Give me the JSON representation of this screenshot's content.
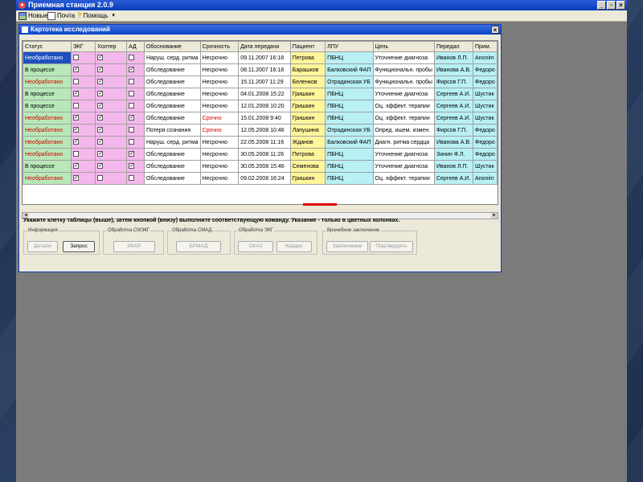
{
  "app": {
    "title": "Приемная станция 2.0.9",
    "window_buttons": [
      "_",
      "▫",
      "×"
    ]
  },
  "menu": {
    "new_label": "Новые",
    "mail_label": "Почта",
    "help_label": "Помощь",
    "help_arrow": "▾"
  },
  "dialog": {
    "title": "Картотека исследований",
    "close": "×"
  },
  "table": {
    "headers": [
      "Статус",
      "ЭКГ",
      "Холтер",
      "АД",
      "Обоснование",
      "Срочность",
      "Дата передачи",
      "Пациент",
      "ЛПУ",
      "Цель",
      "Передал",
      "Прим."
    ],
    "rows": [
      {
        "status": "Необработано",
        "ekg": false,
        "holter": true,
        "ad": false,
        "reason": "Наруш. серд. ритма",
        "urgency": "Несрочно",
        "date": "09.11.2007 16:18",
        "patient": "Петрова",
        "lpu": "ПБНЦ",
        "goal": "Уточнение диагноза",
        "sender": "Иванов Л.П.",
        "note": "Anonim"
      },
      {
        "status": "В процессе",
        "ekg": true,
        "holter": true,
        "ad": true,
        "reason": "Обследование",
        "urgency": "Несрочно",
        "date": "08.11.2007 16:18",
        "patient": "Барашков",
        "lpu": "Балковский ФАП",
        "goal": "Функциональн. пробы",
        "sender": "Иванова А.В.",
        "note": "Федоро"
      },
      {
        "status": "Необработано",
        "ekg": false,
        "holter": true,
        "ad": false,
        "reason": "Обследование",
        "urgency": "Несрочно",
        "date": "15.11.2007 11:29",
        "patient": "Беленков",
        "lpu": "Отрадинская УБ",
        "goal": "Функциональн. пробы",
        "sender": "Фирсов Г.П.",
        "note": "Федоро"
      },
      {
        "status": "В процессе",
        "ekg": true,
        "holter": true,
        "ad": false,
        "reason": "Обследование",
        "urgency": "Несрочно",
        "date": "04.01.2008 15:22",
        "patient": "Гришкин",
        "lpu": "ПБНЦ",
        "goal": "Уточнение диагноза",
        "sender": "Сергеев А.И.",
        "note": "Шустик"
      },
      {
        "status": "В процессе",
        "ekg": false,
        "holter": true,
        "ad": false,
        "reason": "Обследование",
        "urgency": "Несрочно",
        "date": "12.01.2008 10:20",
        "patient": "Гришкин",
        "lpu": "ПБНЦ",
        "goal": "Оц. эффект. терапии",
        "sender": "Сергеев А.И.",
        "note": "Шустик"
      },
      {
        "status": "Необработано",
        "ekg": true,
        "holter": true,
        "ad": true,
        "reason": "Обследование",
        "urgency": "Срочно",
        "date": "15.01.2008 9:40",
        "patient": "Гришкин",
        "lpu": "ПБНЦ",
        "goal": "Оц. эффект. терапии",
        "sender": "Сергеев А.И.",
        "note": "Шустик"
      },
      {
        "status": "Необработано",
        "ekg": true,
        "holter": true,
        "ad": false,
        "reason": "Потеря сознания",
        "urgency": "Срочно",
        "date": "12.05.2008 10:46",
        "patient": "Лапушина",
        "lpu": "Отрадинская УБ",
        "goal": "Опред. ишем. измен.",
        "sender": "Фирсов Г.П.",
        "note": "Федоро"
      },
      {
        "status": "Необработано",
        "ekg": true,
        "holter": true,
        "ad": false,
        "reason": "Наруш. серд. ритма",
        "urgency": "Несрочно",
        "date": "22.05.2008 11:16",
        "patient": "Жданов",
        "lpu": "Балковский ФАП",
        "goal": "Диагн. ритма сердца",
        "sender": "Иванова А.В.",
        "note": "Федоро"
      },
      {
        "status": "Необработано",
        "ekg": false,
        "holter": true,
        "ad": true,
        "reason": "Обследование",
        "urgency": "Несрочно",
        "date": "30.05.2008 11:26",
        "patient": "Петрова",
        "lpu": "ПБНЦ",
        "goal": "Уточнение диагноза",
        "sender": "Зинин Ф.Л.",
        "note": "Федоро"
      },
      {
        "status": "В процессе",
        "ekg": true,
        "holter": true,
        "ad": true,
        "reason": "Обследование",
        "urgency": "Несрочно",
        "date": "30.05.2008 15:46",
        "patient": "Семенова",
        "lpu": "ПБНЦ",
        "goal": "Уточнение диагноза",
        "sender": "Иванов Л.П.",
        "note": "Шустик"
      },
      {
        "status": "Необработано",
        "ekg": true,
        "holter": false,
        "ad": false,
        "reason": "Обследование",
        "urgency": "Несрочно",
        "date": "09.02.2008 16:24",
        "patient": "Гришкин",
        "lpu": "ПБНЦ",
        "goal": "Оц. эффект. терапии",
        "sender": "Сергеев А.И.",
        "note": "Anonim"
      }
    ],
    "check_mark": "✓"
  },
  "scroll": {
    "left": "◂",
    "right": "▸"
  },
  "hint": "Укажите клетку таблицы (выше), затем кнопкой (внизу) выполните соответствующую команду. Указание - только в цветных колонках.",
  "groups": {
    "info": {
      "legend": "Информация",
      "details": "Детали",
      "request": "Запрос"
    },
    "smeg": {
      "legend": "Обработка СМЭКГ",
      "button": "ИКАР"
    },
    "smad": {
      "legend": "Обработка СМАД",
      "button": "БРМАД"
    },
    "ekg": {
      "legend": "Обработка ЭКГ",
      "btn1": "ОКАЗ",
      "btn2": "Кардис"
    },
    "conclusion": {
      "legend": "Врачебное заключение",
      "btn1": "Заключение",
      "btn2": "Подтвердить"
    }
  },
  "colors": {
    "status_green": "#b8e8b8",
    "selected_blue": "#1f50c0",
    "pink_columns": "#f4b8ec",
    "patient_yellow": "#fff59a",
    "cyan_columns": "#b8f0f4",
    "urgent_red": "#d00000",
    "annotation_red": "#e00000"
  }
}
